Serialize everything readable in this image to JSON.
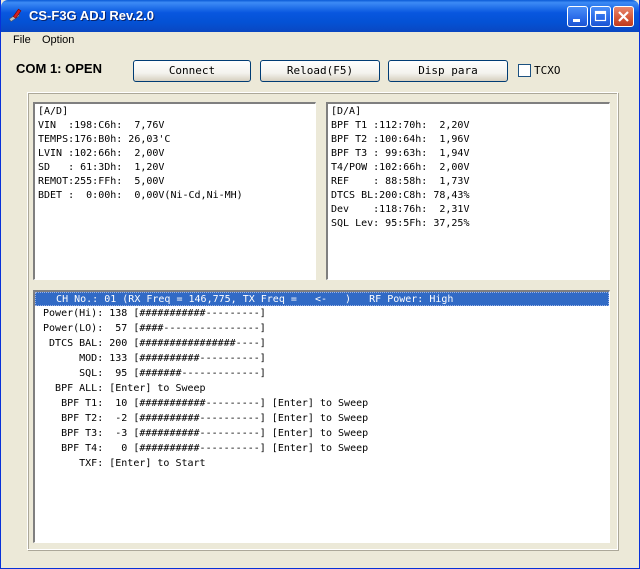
{
  "window": {
    "title": "CS-F3G ADJ Rev.2.0"
  },
  "menu": [
    "File",
    "Option"
  ],
  "status": {
    "com": "COM 1: OPEN"
  },
  "buttons": {
    "connect": "Connect",
    "reload": "Reload(F5)",
    "disp": "Disp para"
  },
  "tcxo": {
    "label": "TCXO",
    "checked": false
  },
  "ad_panel": {
    "lines": [
      "[A/D]",
      "VIN  :198:C6h:  7,76V",
      "TEMPS:176:B0h: 26,03'C",
      "LVIN :102:66h:  2,00V",
      "SD   : 61:3Dh:  1,20V",
      "REMOT:255:FFh:  5,00V",
      "BDET :  0:00h:  0,00V(Ni-Cd,Ni-MH)"
    ]
  },
  "da_panel": {
    "lines": [
      "[D/A]",
      "BPF T1 :112:70h:  2,20V",
      "BPF T2 :100:64h:  1,96V",
      "BPF T3 : 99:63h:  1,94V",
      "T4/POW :102:66h:  2,00V",
      "REF    : 88:58h:  1,73V",
      "DTCS BL:200:C8h: 78,43%",
      "Dev    :118:76h:  2,31V",
      "SQL Lev: 95:5Fh: 37,25%"
    ]
  },
  "ch_panel": {
    "header": "   CH No.: 01 (RX Freq = 146,775, TX Freq =   <-   )   RF Power: High",
    "lines": [
      " Power(Hi): 138 [###########---------]",
      " Power(LO):  57 [####----------------]",
      "  DTCS BAL: 200 [################----]",
      "       MOD: 133 [##########----------]",
      "       SQL:  95 [#######-------------]",
      "   BPF ALL: [Enter] to Sweep",
      "    BPF T1:  10 [###########---------] [Enter] to Sweep",
      "    BPF T2:  -2 [##########----------] [Enter] to Sweep",
      "    BPF T3:  -3 [##########----------] [Enter] to Sweep",
      "    BPF T4:   0 [##########----------] [Enter] to Sweep",
      "       TXF: [Enter] to Start"
    ]
  }
}
